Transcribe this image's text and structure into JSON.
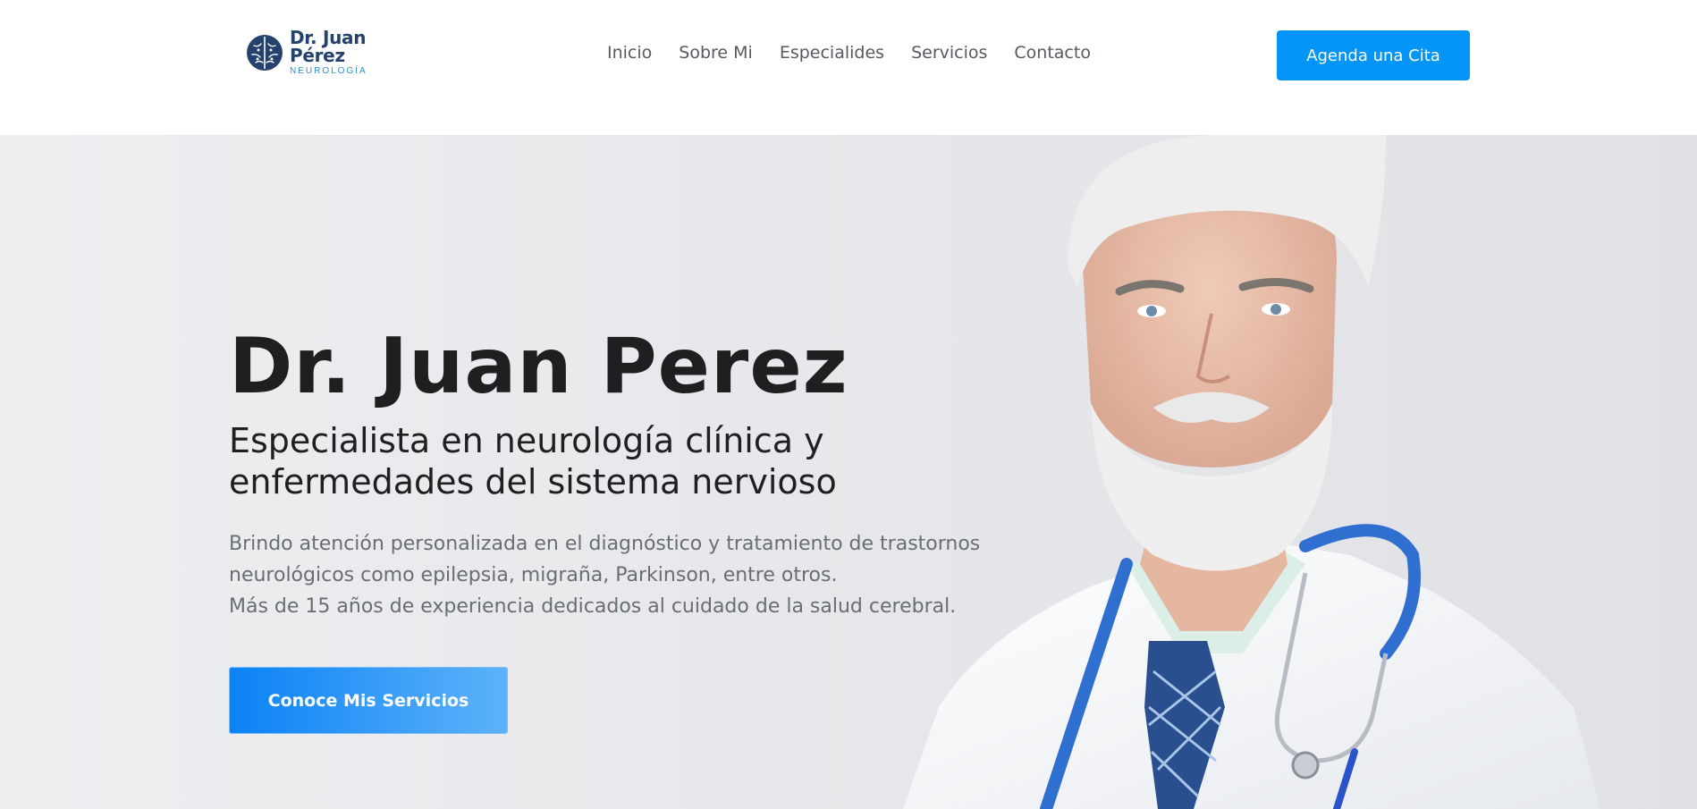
{
  "brand": {
    "name": "Dr. Juan Pérez",
    "subtitle": "NEUROLOGÍA",
    "color": "#24426b",
    "accent": "#2f8fc9",
    "icon": "brain-icon"
  },
  "nav": {
    "items": [
      {
        "label": "Inicio"
      },
      {
        "label": "Sobre Mi"
      },
      {
        "label": "Especialides"
      },
      {
        "label": "Servicios"
      },
      {
        "label": "Contacto"
      }
    ]
  },
  "header": {
    "cta_label": "Agenda una Cita",
    "cta_color": "#0495f6"
  },
  "hero": {
    "title": "Dr. Juan Perez",
    "subtitle": "Especialista en neurología clínica y enfermedades del sistema nervioso",
    "description_lines": [
      "Brindo atención personalizada en el diagnóstico y tratamiento de trastornos",
      "neurológicos como epilepsia, migraña, Parkinson, entre otros.",
      "Más de 15 años de experiencia dedicados al cuidado de la salud cerebral."
    ],
    "cta_label": "Conoce Mis Servicios",
    "photo": "doctor-portrait"
  }
}
